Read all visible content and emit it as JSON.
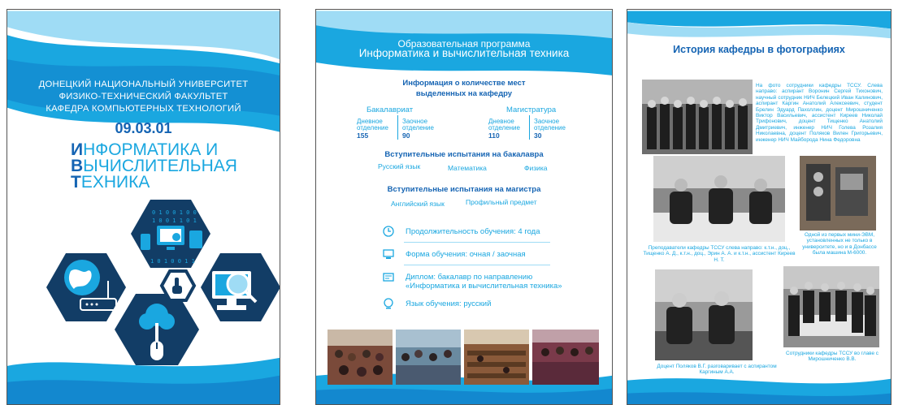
{
  "panel1": {
    "university_lines": [
      "ДОНЕЦКИЙ НАЦИОНАЛЬНЫЙ УНИВЕРСИТЕТ",
      "ФИЗИКО-ТЕХНИЧЕСКИЙ ФАКУЛЬТЕТ",
      "КАФЕДРА КОМПЬЮТЕРНЫХ ТЕХНОЛОГИЙ"
    ],
    "code": "09.03.01",
    "title_lines": [
      {
        "initial": "И",
        "rest": "НФОРМАТИКА И"
      },
      {
        "initial": "В",
        "rest": "ЫЧИСЛИТЕЛЬНАЯ"
      },
      {
        "initial": "Т",
        "rest": "ЕХНИКА"
      }
    ],
    "hex_digits_top": "0 1 0 0 1 0 0",
    "hex_digits_top2": "1 0 0 1 1 0 1",
    "hex_digits_bottom": "1 0 1 0 0 1 1",
    "icons": [
      "globe-icon",
      "router-icon",
      "devices-icon",
      "gear-icon",
      "hand-pointer-icon",
      "computer-magnifier-icon",
      "tree-mouse-icon"
    ],
    "colors": {
      "dark_blue": "#1564b3",
      "light_blue": "#1aa7e0",
      "hex_navy": "#123d66"
    }
  },
  "panel2": {
    "header_line1": "Образовательная программа",
    "header_line2": "Информатика и вычислительная техника",
    "places_title_1": "Информация о количестве мест",
    "places_title_2": "выделенных на кафедру",
    "bachelor_label": "Бакалавриат",
    "master_label": "Магистратура",
    "fulltime_1": "Дневное",
    "fulltime_2": "отделение",
    "parttime_1": "Заочное",
    "parttime_2": "отделение",
    "bachelor_fulltime": "155",
    "bachelor_parttime": "90",
    "master_fulltime": "110",
    "master_parttime": "30",
    "bachelor_exams_title": "Вступительные испытания на бакалавра",
    "bachelor_exams": [
      "Русский язык",
      "Математика",
      "Физика"
    ],
    "master_exams_title": "Вступительные испытания на магистра",
    "master_exams": [
      "Английский язык",
      "Профильный предмет"
    ],
    "info": [
      {
        "icon": "clock-icon",
        "text": "Продолжительность обучения: 4 года"
      },
      {
        "icon": "monitor-icon",
        "text": "Форма обучения: очная / заочная"
      },
      {
        "icon": "diploma-icon",
        "text_1": "Диплом: бакалавр по направлению",
        "text_2": "«Информатика и вычислительная техника»"
      },
      {
        "icon": "globe-icon",
        "text": "Язык обучения: русский"
      }
    ]
  },
  "panel3": {
    "title": "История кафедры в фотографиях",
    "caption1": "На фото сотрудники кафедры ТССУ. Слева направо: аспирант Воронин Сергей Тихонович, научный сотрудник НИЧ Белецкий Иван Калинович, аспирант Каргин Анатолий Алексеевич, студент Брелин Эдуард Пахоллин, доцент Мирошниченко Виктор Васильевич, ассистент Киреев Николай Трифонович, доцент Тищенко Анатолий Дмитриевич, инженер НИЧ Голева Розалия Николаевна, доцент Поляков Вилен Григорьевич, инженер НИЧ Майборода Нина Федоровна",
    "caption2": "Преподаватели кафедры ТССУ слева направо: к.т.н., доц., Тищенко А. Д., к.т.н., доц., Эрин А. А. и к.т.н., ассистент Киреев Н. Т.",
    "caption3": "Одной из первых мини-ЭВМ, установленных не только в университете, но и в Донбассе была машина М-6000.",
    "caption4": "Доцент Поляков В.Г. разговаривает с аспирантом Каргиным А.А.",
    "caption5": "Сотрудники кафедры ТССУ во главе с Мирошниченко В.В."
  }
}
